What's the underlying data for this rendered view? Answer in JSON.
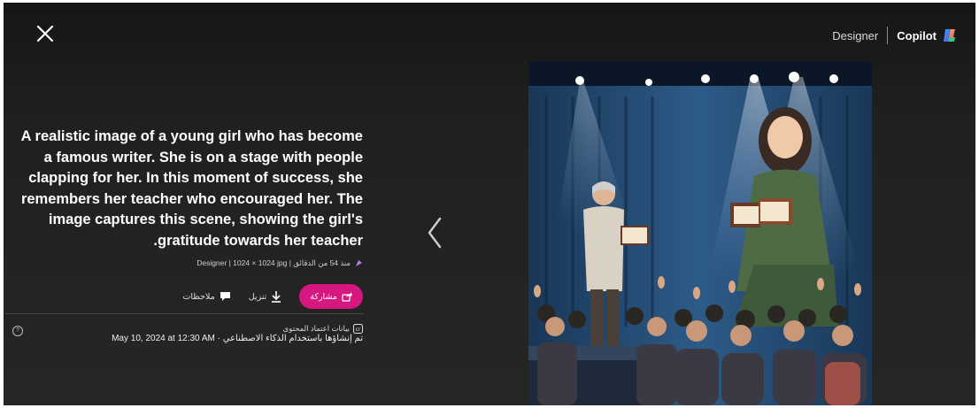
{
  "header": {
    "designer_label": "Designer",
    "copilot_label": "Copilot"
  },
  "prompt": {
    "text": "A realistic image of a young girl who has become a famous writer. She is on a stage with people clapping for her. In this moment of success, she remembers her teacher who encouraged her. The image captures this scene, showing the girl's gratitude towards her teacher."
  },
  "meta": {
    "text": "منذ 54 من الدقائق | Designer | 1024 × 1024 jpg"
  },
  "actions": {
    "share_label": "مشاركة",
    "download_label": "تنزيل",
    "feedback_label": "ملاحظات"
  },
  "credentials": {
    "title": "بيانات اعتماد المحتوى",
    "line": "تم إنشاؤها باستخدام الذكاء الاصطناعي · May 10, 2024 at 12:30 AM"
  },
  "colors": {
    "share_button": "#d6177f",
    "background": "#222222"
  },
  "icons": {
    "close": "close-icon",
    "previous": "chevron-left-icon",
    "share": "share-icon",
    "download": "download-icon",
    "feedback": "comment-icon",
    "help": "help-icon",
    "credentials": "content-credentials-icon",
    "designer": "designer-icon",
    "copilot": "copilot-logo-icon"
  }
}
